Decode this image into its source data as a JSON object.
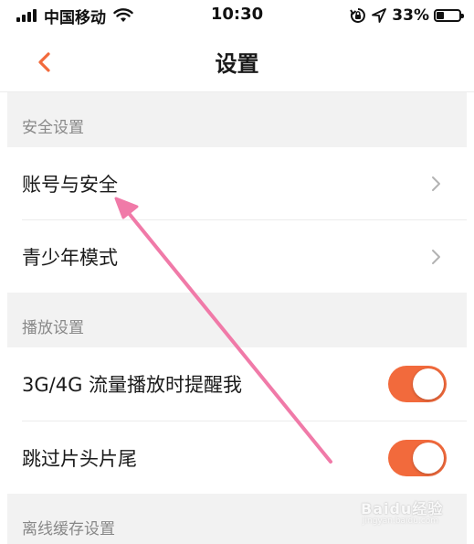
{
  "status_bar": {
    "carrier": "中国移动",
    "time": "10:30",
    "battery_percent": "33%",
    "battery_level": 0.33,
    "icons": [
      "signal-icon",
      "wifi-icon",
      "rotation-lock-icon",
      "location-arrow-icon",
      "battery-icon"
    ]
  },
  "nav": {
    "back_icon": "chevron-left-icon",
    "title": "设置",
    "accent_color": "#f26a3c"
  },
  "sections": [
    {
      "header": "安全设置",
      "items": [
        {
          "label": "账号与安全",
          "control": "chevron-right-icon"
        },
        {
          "label": "青少年模式",
          "control": "chevron-right-icon"
        }
      ]
    },
    {
      "header": "播放设置",
      "items": [
        {
          "label": "3G/4G 流量播放时提醒我",
          "control": "toggle",
          "on": true
        },
        {
          "label": "跳过片头片尾",
          "control": "toggle",
          "on": true
        }
      ]
    },
    {
      "header": "离线缓存设置",
      "items": []
    }
  ],
  "colors": {
    "toggle_on": "#f26a3c",
    "section_bg": "#f2f2f2",
    "annotation_arrow": "#f07aa8"
  },
  "watermark": {
    "text": "Baidu经验",
    "sub": "jingyan.baidu.com"
  }
}
